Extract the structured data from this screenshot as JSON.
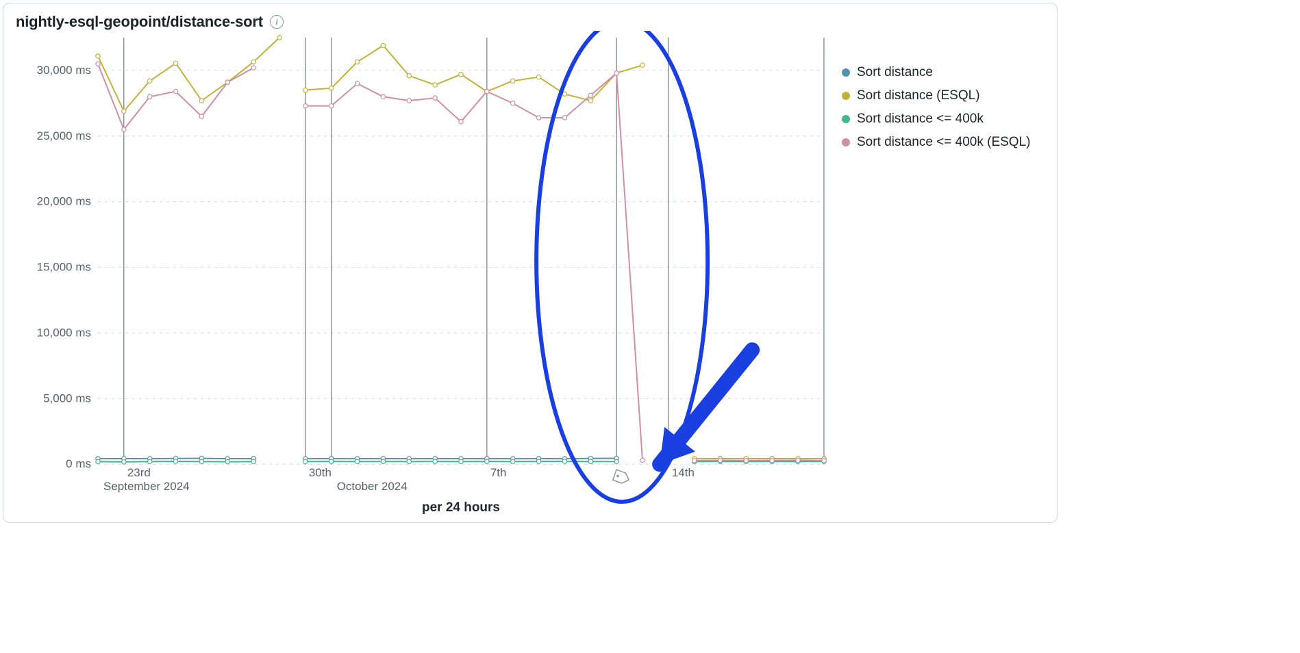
{
  "panel": {
    "title": "nightly-esql-geopoint/distance-sort",
    "footer": "per 24 hours"
  },
  "legend": [
    {
      "label": "Sort distance",
      "color": "#5293b3"
    },
    {
      "label": "Sort distance (ESQL)",
      "color": "#c3b23a"
    },
    {
      "label": "Sort distance <= 400k",
      "color": "#3fb98d"
    },
    {
      "label": "Sort distance <= 400k (ESQL)",
      "color": "#cf8fa7"
    }
  ],
  "chart_data": {
    "type": "line",
    "xlabel": "",
    "ylabel": "",
    "ylim": [
      0,
      32500
    ],
    "y_ticks_ms": [
      0,
      5000,
      10000,
      15000,
      20000,
      25000,
      30000
    ],
    "x_ticks": [
      {
        "i": 1,
        "label": "23rd"
      },
      {
        "i": 7,
        "short": "",
        "label": "September 2024",
        "as_month": true,
        "month_i": 0
      },
      {
        "i": 8,
        "label": "30th"
      },
      {
        "i": 9,
        "label": "October 2024",
        "as_month": true,
        "month_i": 9
      },
      {
        "i": 15,
        "label": "7th"
      },
      {
        "i": 20,
        "label": ""
      },
      {
        "i": 22,
        "label": "14th"
      },
      {
        "i": 28,
        "label": ""
      }
    ],
    "vlines_i": [
      1,
      8,
      9,
      15,
      20,
      22,
      28
    ],
    "month_labels": [
      {
        "i": 0,
        "label": "September 2024"
      },
      {
        "i": 9,
        "label": "October 2024"
      }
    ],
    "tag_marker_i": 20,
    "series": [
      {
        "name": "Sort distance",
        "color": "#5293b3",
        "segments": [
          {
            "start_i": 0,
            "values": [
              420,
              430,
              420,
              440,
              450,
              420,
              430
            ]
          },
          {
            "start_i": 8,
            "values": [
              420,
              430,
              420,
              430,
              420,
              430,
              420,
              430,
              420,
              430,
              420,
              440,
              450
            ]
          },
          {
            "start_i": 23,
            "values": [
              420,
              430,
              420,
              430,
              420,
              430
            ]
          }
        ]
      },
      {
        "name": "Sort distance (ESQL)",
        "color": "#c3b23a",
        "segments": [
          {
            "start_i": 0,
            "values": [
              31100,
              26900,
              29200,
              30550,
              27700,
              29100,
              30650,
              32500
            ]
          },
          {
            "start_i": 8,
            "values": [
              28500,
              28650,
              30650,
              31900,
              29600,
              28900,
              29700,
              28400,
              29200,
              29500,
              28200,
              27700,
              29800,
              30400
            ]
          },
          {
            "start_i": 23,
            "values": [
              430,
              420,
              430,
              420,
              430,
              420
            ]
          }
        ]
      },
      {
        "name": "Sort distance <= 400k",
        "color": "#3fb98d",
        "segments": [
          {
            "start_i": 0,
            "values": [
              200,
              180,
              200,
              220,
              200,
              190,
              200
            ]
          },
          {
            "start_i": 8,
            "values": [
              200,
              210,
              200,
              210,
              200,
              210,
              200,
              210,
              200,
              210,
              220,
              210,
              200
            ]
          },
          {
            "start_i": 23,
            "values": [
              200,
              210,
              200,
              210,
              200,
              210
            ]
          }
        ]
      },
      {
        "name": "Sort distance <= 400k (ESQL)",
        "color": "#cf8fa7",
        "segments": [
          {
            "start_i": 0,
            "values": [
              30500,
              25500,
              28000,
              28400,
              26500,
              29100,
              30200
            ]
          },
          {
            "start_i": 8,
            "values": [
              27300,
              27300,
              29000,
              28000,
              27700,
              27900,
              26100,
              28400,
              27500,
              26400,
              26400,
              28100,
              29800,
              300
            ]
          },
          {
            "start_i": 23,
            "values": [
              280,
              290,
              280,
              290,
              300,
              280
            ]
          }
        ]
      }
    ]
  },
  "annotation": {
    "ellipse_note": "blue ellipse highlights the drop around Oct 11",
    "arrow_note": "blue arrow pointing to the drop"
  }
}
